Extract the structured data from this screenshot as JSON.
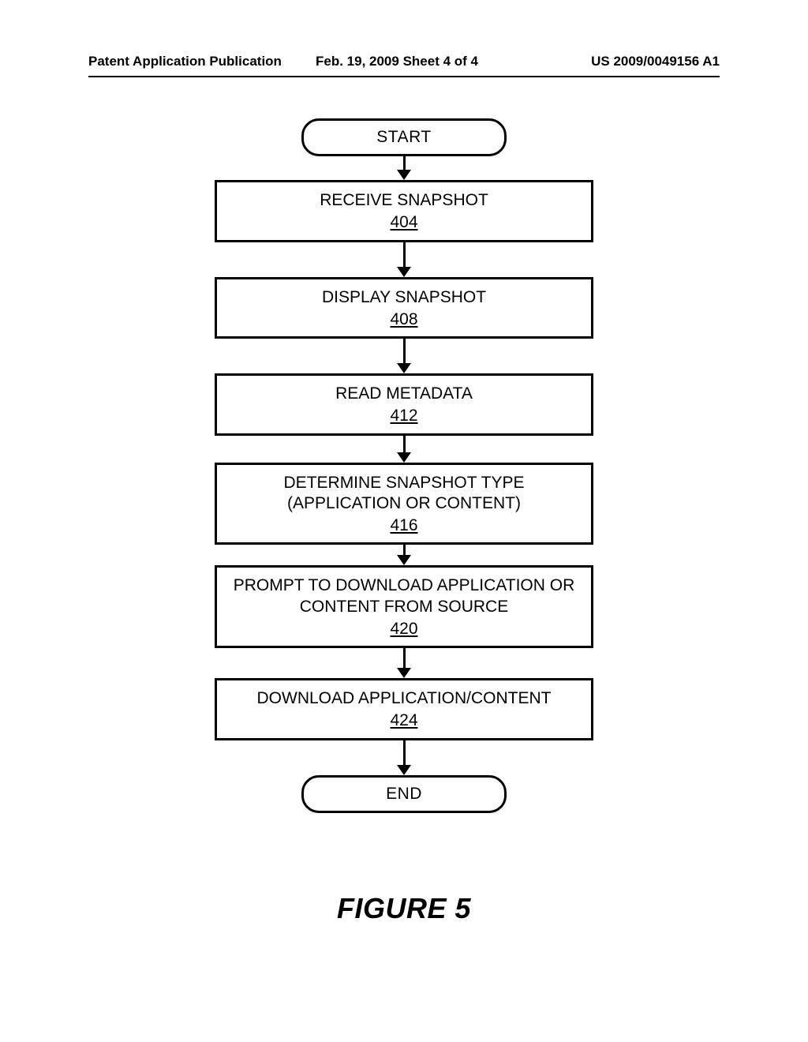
{
  "header": {
    "left": "Patent Application Publication",
    "middle": "Feb. 19, 2009  Sheet 4 of 4",
    "right": "US 2009/0049156 A1"
  },
  "flowchart": {
    "start": "START",
    "end": "END",
    "steps": [
      {
        "text": "RECEIVE SNAPSHOT",
        "ref": "404"
      },
      {
        "text": "DISPLAY SNAPSHOT",
        "ref": "408"
      },
      {
        "text": "READ METADATA",
        "ref": "412"
      },
      {
        "text": "DETERMINE SNAPSHOT TYPE (APPLICATION OR CONTENT)",
        "ref": "416"
      },
      {
        "text": "PROMPT TO DOWNLOAD APPLICATION OR CONTENT FROM SOURCE",
        "ref": "420"
      },
      {
        "text": "DOWNLOAD APPLICATION/CONTENT",
        "ref": "424"
      }
    ]
  },
  "figure_label": "FIGURE 5"
}
